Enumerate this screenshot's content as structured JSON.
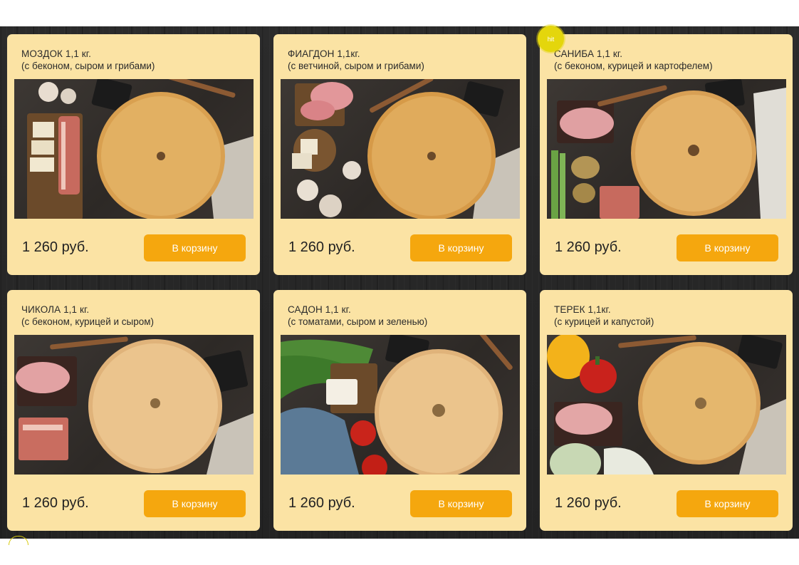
{
  "products": [
    {
      "title": "МОЗДОК 1,1 кг.",
      "subtitle": "(с беконом, сыром и грибами)",
      "price": "1 260 руб.",
      "button": "В корзину"
    },
    {
      "title": "ФИАГДОН 1,1кг.",
      "subtitle": "(с ветчиной, сыром и грибами)",
      "price": "1 260 руб.",
      "button": "В корзину"
    },
    {
      "title": "САНИБА 1,1 кг.",
      "subtitle": "(с беконом, курицей и картофелем)",
      "price": "1 260 руб.",
      "button": "В корзину"
    },
    {
      "title": "ЧИКОЛА 1,1 кг.",
      "subtitle": "(с беконом, курицей и сыром)",
      "price": "1 260 руб.",
      "button": "В корзину"
    },
    {
      "title": "САДОН 1,1 кг.",
      "subtitle": "(с томатами, сыром и зеленью)",
      "price": "1 260 руб.",
      "button": "В корзину"
    },
    {
      "title": "ТЕРЕК 1,1кг.",
      "subtitle": "(с курицей и капустой)",
      "price": "1 260 руб.",
      "button": "В корзину"
    }
  ],
  "hit_badge": "hit",
  "colors": {
    "card": "#fbe3a4",
    "button": "#f5a70e",
    "badge": "#e4d60c",
    "background": "#262626"
  }
}
